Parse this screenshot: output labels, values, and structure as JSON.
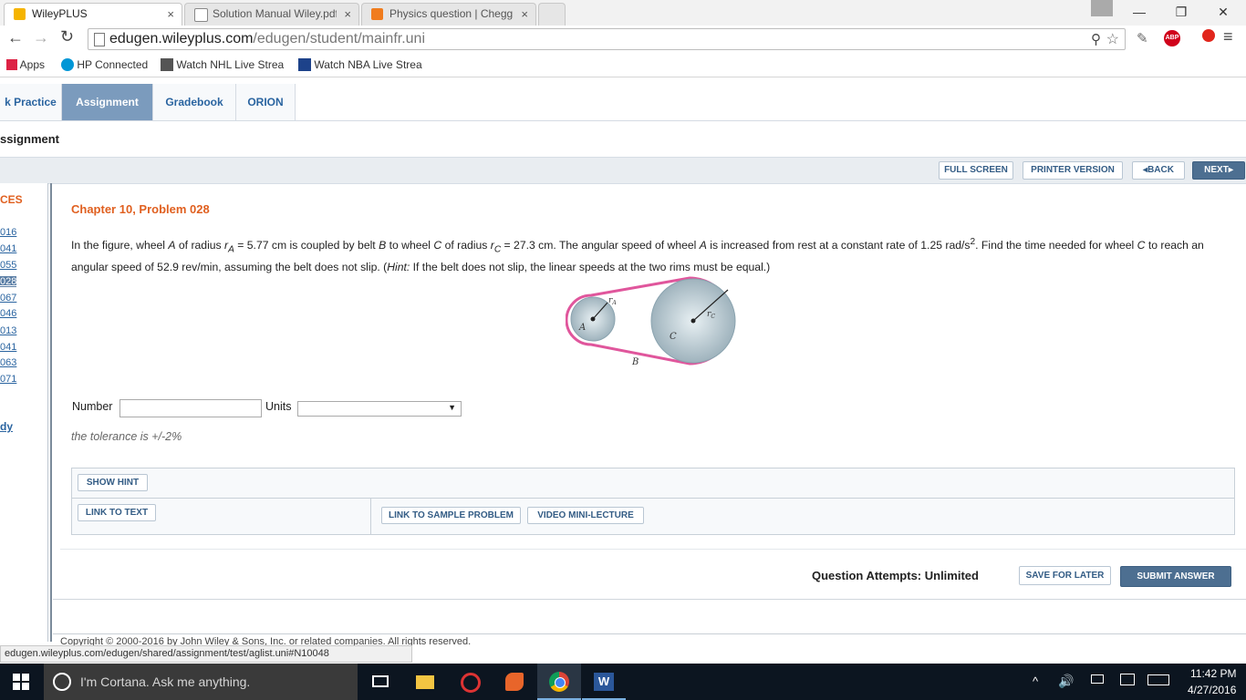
{
  "browser": {
    "tabs": [
      {
        "title": "WileyPLUS",
        "close": "×",
        "color": "#f5b400"
      },
      {
        "title": "Solution Manual Wiley.pdf",
        "close": "×",
        "color": "#ffffff"
      },
      {
        "title": "Physics question | Chegg.",
        "close": "×",
        "color": "#f07c1e"
      }
    ],
    "url_host": "edugen.wileyplus.com",
    "url_path": "/edugen/student/mainfr.uni",
    "bookmarks": [
      {
        "label": "Apps",
        "icon": "apps-grid-icon"
      },
      {
        "label": "HP Connected",
        "icon": "hp-logo-icon"
      },
      {
        "label": "Watch NHL Live Strea",
        "icon": "nhl-icon"
      },
      {
        "label": "Watch NBA Live Strea",
        "icon": "nba-icon"
      }
    ],
    "extensions": {
      "abp": "ABP"
    }
  },
  "nav": {
    "tabs": [
      {
        "label": "k Practice"
      },
      {
        "label": "Assignment"
      },
      {
        "label": "Gradebook"
      },
      {
        "label": "ORION"
      }
    ]
  },
  "breadcrumb": "ssignment",
  "toolbar": {
    "full_screen": "FULL SCREEN",
    "printer": "PRINTER VERSION",
    "back": "BACK",
    "next": "NEXT"
  },
  "sidebar": {
    "heading": "CES",
    "links": [
      "016",
      "041",
      "055",
      "028",
      "067",
      "046",
      "013",
      "041",
      "063",
      "071"
    ],
    "study": "dy"
  },
  "problem": {
    "title": "Chapter 10, Problem 028",
    "text_1": "In the figure, wheel ",
    "text_A": "A",
    "text_2": " of radius ",
    "text_rA": "r",
    "text_rA_sub": "A",
    "text_3": " = 5.77 cm is coupled by belt ",
    "text_B": "B",
    "text_4": " to wheel ",
    "text_C": "C",
    "text_5": " of radius ",
    "text_rC": "r",
    "text_rC_sub": "C",
    "text_6": " = 27.3 cm. The angular speed of wheel ",
    "text_A2": "A",
    "text_7": " is increased from rest at a constant rate of 1.25 rad/s",
    "text_sup": "2",
    "text_8": ". Find the time needed for wheel ",
    "text_C2": "C",
    "text_9": " to reach an angular speed of 52.9 rev/min, assuming the belt does not slip. (",
    "text_hint": "Hint:",
    "text_10": " If the belt does not slip, the linear speeds at the two rims must be equal.)",
    "figure": {
      "label_rA": "r",
      "label_rA_sub": "A",
      "label_rC": "r",
      "label_rC_sub": "C",
      "label_A": "A",
      "label_C": "C",
      "label_B": "B"
    }
  },
  "answer": {
    "number_label": "Number",
    "number_value": "",
    "units_label": "Units",
    "units_value": "",
    "tolerance": "the tolerance is +/-2%"
  },
  "help": {
    "show_hint": "SHOW HINT",
    "link_text": "LINK TO TEXT",
    "sample": "LINK TO SAMPLE PROBLEM",
    "video": "VIDEO MINI-LECTURE"
  },
  "footer": {
    "attempts": "Question Attempts: Unlimited",
    "save": "SAVE FOR LATER",
    "submit": "SUBMIT ANSWER",
    "copyright": "Copyright © 2000-2016 by John Wiley & Sons, Inc. or related companies. All rights reserved."
  },
  "status_url": "edugen.wileyplus.com/edugen/shared/assignment/test/aglist.uni#N10048",
  "taskbar": {
    "cortana": "I'm Cortana. Ask me anything.",
    "time": "11:42 PM",
    "date": "4/27/2016"
  }
}
